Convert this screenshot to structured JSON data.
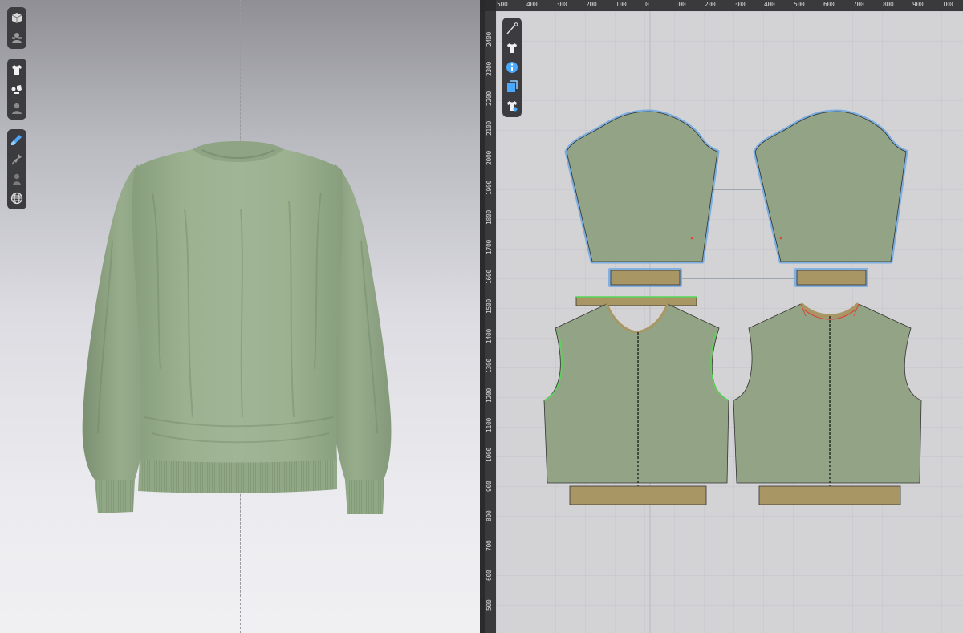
{
  "colors": {
    "garment": "#97ad8c",
    "garment_dark": "#7e9474",
    "pattern_fill": "#93a386",
    "binding_fill": "#a89765",
    "outline_selected": "#6fa8e0",
    "outline_green": "#57d657",
    "outline_red": "#d84a3a",
    "toolbar_bg": "#3c3c40",
    "accent_blue": "#4aa8ff"
  },
  "viewport3d": {
    "toolbar_groups": [
      {
        "tools": [
          "cube-view-icon",
          "avatar-pose-icon"
        ]
      },
      {
        "tools": [
          "tshirt-icon",
          "fitting-icon",
          "avatar-icon"
        ]
      },
      {
        "tools": [
          "texture-brush-icon",
          "pin-icon",
          "avatar-silhouette-icon"
        ]
      },
      {
        "tools": [
          "globe-icon"
        ]
      }
    ]
  },
  "viewport2d": {
    "ruler_top_labels": [
      "500",
      "400",
      "300",
      "200",
      "100",
      "0",
      "100",
      "200",
      "300",
      "400",
      "500",
      "600",
      "700",
      "800",
      "900",
      "100"
    ],
    "ruler_left_labels": [
      "2400",
      "2300",
      "2200",
      "2100",
      "2000",
      "1900",
      "1800",
      "1700",
      "1600",
      "1500",
      "1400",
      "1300",
      "1200",
      "1100",
      "1000",
      "900",
      "800",
      "700",
      "600",
      "500"
    ],
    "toolbar": [
      "edit-curve-icon",
      "tshirt-icon",
      "info-icon",
      "texture-sheet-icon",
      "tshirt-settings-icon"
    ]
  },
  "patterns": [
    {
      "id": "sleeve-left",
      "kind": "sleeve",
      "selected": true
    },
    {
      "id": "sleeve-right",
      "kind": "sleeve",
      "selected": true
    },
    {
      "id": "cuff-left",
      "kind": "binding",
      "selected": true
    },
    {
      "id": "cuff-right",
      "kind": "binding",
      "selected": true
    },
    {
      "id": "neck-binding",
      "kind": "binding",
      "selected": false
    },
    {
      "id": "back-body",
      "kind": "body",
      "selected": false
    },
    {
      "id": "front-body",
      "kind": "body",
      "selected": false
    },
    {
      "id": "hem-band-back",
      "kind": "binding",
      "selected": false
    },
    {
      "id": "hem-band-front",
      "kind": "binding",
      "selected": false
    }
  ]
}
